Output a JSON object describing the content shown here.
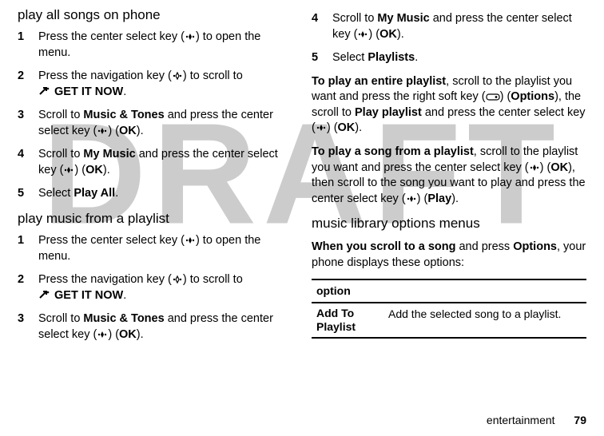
{
  "watermark": "DRAFT",
  "icons": {
    "center": "center-select-icon",
    "nav": "navigation-key-icon",
    "arrow": "get-it-now-arrow-icon",
    "softkey": "right-soft-key-icon"
  },
  "labels": {
    "get_it_now": "GET IT NOW",
    "music_tones": "Music & Tones",
    "ok": "OK",
    "my_music": "My Music",
    "play_all": "Play All",
    "playlists": "Playlists",
    "options": "Options",
    "play_playlist": "Play playlist",
    "play": "Play",
    "add_to_playlist": "Add To Playlist"
  },
  "left": {
    "h_all": "play all songs on phone",
    "h_playlist": "play music from a playlist",
    "steps_all": [
      {
        "n": "1",
        "pre": "Press the center select key (",
        "post": ") to open the menu."
      },
      {
        "n": "2",
        "pre": "Press the navigation key (",
        "mid": ") to scroll to ",
        "post": "."
      },
      {
        "n": "3",
        "pre": "Scroll to ",
        "mid": " and press the center select key (",
        "post": ")."
      },
      {
        "n": "4",
        "pre": "Scroll to ",
        "mid": " and press the center select key (",
        "post": ")."
      },
      {
        "n": "5",
        "pre": "Select ",
        "post": "."
      }
    ],
    "steps_pl": [
      {
        "n": "1",
        "pre": "Press the center select key (",
        "post": ") to open the menu."
      },
      {
        "n": "2",
        "pre": "Press the navigation key (",
        "mid": ") to scroll to ",
        "post": "."
      },
      {
        "n": "3",
        "pre": "Scroll to ",
        "mid": " and press the center select key (",
        "post": ")."
      }
    ]
  },
  "right": {
    "steps_cont": [
      {
        "n": "4",
        "pre": "Scroll to ",
        "mid": " and press the center select key (",
        "post": ")."
      },
      {
        "n": "5",
        "pre": "Select ",
        "post": "."
      }
    ],
    "p1": {
      "lead": "To play an entire playlist",
      "a": ", scroll to the playlist you want and press the right soft key (",
      "b": ") (",
      "c": "), the scroll to ",
      "d": " and press the center select key (",
      "e": ") (",
      "f": ")."
    },
    "p2": {
      "lead": "To play a song from a playlist",
      "a": ", scroll to the playlist you want and press the center select key (",
      "b": ") (",
      "c": "), then scroll to the song you want to play and press the center select key (",
      "d": ") (",
      "e": ")."
    },
    "h_menus": "music library options menus",
    "p3": {
      "lead": "When you scroll to a song",
      "a": " and press ",
      "b": ", your phone displays these options:"
    },
    "table": {
      "header": "option",
      "row_desc": "Add the selected song to a playlist."
    }
  },
  "footer": {
    "section": "entertainment",
    "page": "79"
  }
}
